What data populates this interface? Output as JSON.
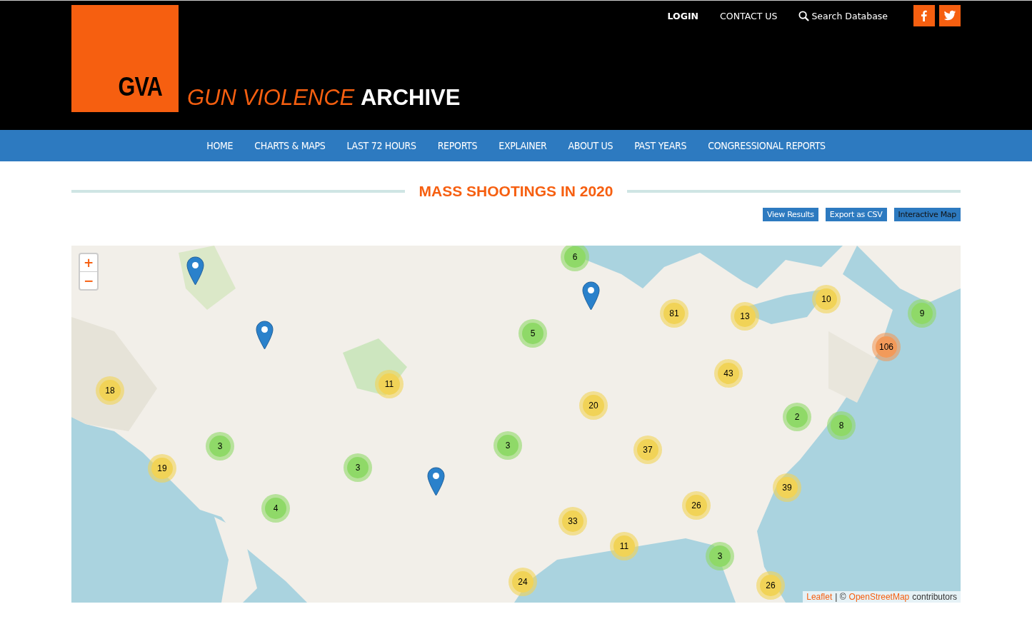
{
  "header": {
    "logo": "GVA",
    "title_italic": "GUN VIOLENCE",
    "title_bold": "ARCHIVE",
    "links": [
      {
        "label": "LOGIN",
        "kind": "strong"
      },
      {
        "label": "CONTACT US",
        "kind": "plain"
      },
      {
        "label": "Search Database",
        "kind": "search"
      }
    ],
    "social": [
      {
        "kind": "facebook"
      },
      {
        "kind": "twitter"
      }
    ]
  },
  "nav": [
    "HOME",
    "CHARTS & MAPS",
    "LAST 72 HOURS",
    "REPORTS",
    "EXPLAINER",
    "ABOUT US",
    "PAST YEARS",
    "CONGRESSIONAL REPORTS"
  ],
  "page_title": "MASS SHOOTINGS IN 2020",
  "tabs": [
    {
      "label": "View Results",
      "selected": false
    },
    {
      "label": "Export as CSV",
      "selected": false
    },
    {
      "label": "Interactive Map",
      "selected": true
    }
  ],
  "map": {
    "zoom": [
      "+",
      "−"
    ],
    "clusters": [
      {
        "count": "6",
        "color": "#8fd968"
      },
      {
        "count": "18",
        "color": "#f1d357"
      },
      {
        "count": "11",
        "color": "#f1d357"
      },
      {
        "count": "5",
        "color": "#8fd968"
      },
      {
        "count": "81",
        "color": "#f1d357"
      },
      {
        "count": "13",
        "color": "#f1d357"
      },
      {
        "count": "10",
        "color": "#f1d357"
      },
      {
        "count": "9",
        "color": "#8fd968"
      },
      {
        "count": "106",
        "color": "#f29a5a"
      },
      {
        "count": "43",
        "color": "#f1d357"
      },
      {
        "count": "20",
        "color": "#f1d357"
      },
      {
        "count": "2",
        "color": "#8fd968"
      },
      {
        "count": "8",
        "color": "#8fd968"
      },
      {
        "count": "3",
        "color": "#8fd968"
      },
      {
        "count": "3",
        "color": "#8fd968"
      },
      {
        "count": "37",
        "color": "#f1d357"
      },
      {
        "count": "19",
        "color": "#f1d357"
      },
      {
        "count": "3",
        "color": "#8fd968"
      },
      {
        "count": "39",
        "color": "#f1d357"
      },
      {
        "count": "4",
        "color": "#8fd968"
      },
      {
        "count": "26",
        "color": "#f1d357"
      },
      {
        "count": "33",
        "color": "#f1d357"
      },
      {
        "count": "11",
        "color": "#f1d357"
      },
      {
        "count": "3",
        "color": "#8fd968"
      },
      {
        "count": "24",
        "color": "#f1d357"
      },
      {
        "count": "26",
        "color": "#f1d357"
      }
    ],
    "attribution": {
      "link1": "Leaflet",
      "sep": "| ©",
      "link2": "OpenStreetMap",
      "tail": "contributors"
    }
  }
}
